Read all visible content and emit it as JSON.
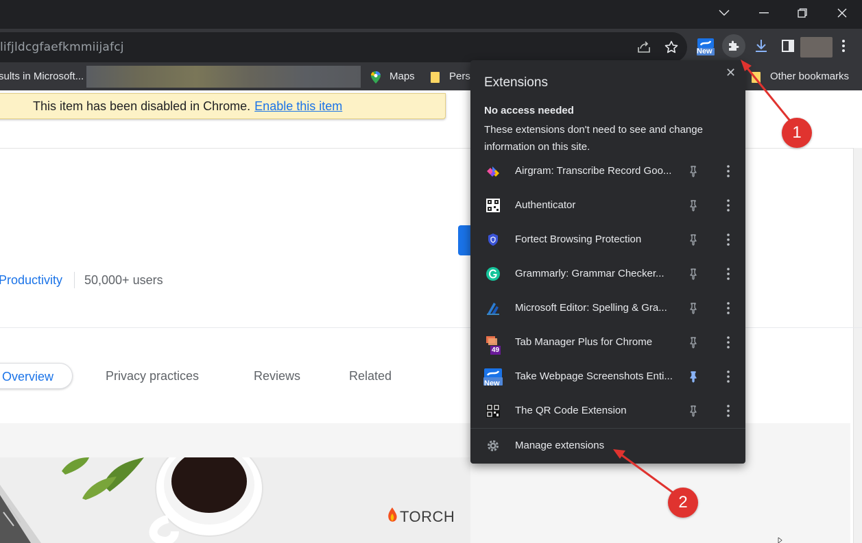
{
  "omnibox": {
    "url_fragment": "lifjldcgfaefkmmiijafcj"
  },
  "toolbar": {
    "new_badge": "New"
  },
  "bookmarks": {
    "item1": "sults in Microsoft...",
    "maps": "Maps",
    "personal": "Perso",
    "other": "Other bookmarks"
  },
  "infobar": {
    "message": "This item has been disabled in Chrome.",
    "link": "Enable this item"
  },
  "store": {
    "category": "Productivity",
    "users": "50,000+ users",
    "tabs": [
      "Overview",
      "Privacy practices",
      "Reviews",
      "Related"
    ],
    "gallery_brand": "TORCH"
  },
  "popup": {
    "title": "Extensions",
    "section_heading": "No access needed",
    "section_desc": "These extensions don't need to see and change information on this site.",
    "extensions": [
      {
        "name": "Airgram: Transcribe Record Goo...",
        "pinned": false
      },
      {
        "name": "Authenticator",
        "pinned": false
      },
      {
        "name": "Fortect Browsing Protection",
        "pinned": false
      },
      {
        "name": "Grammarly: Grammar Checker...",
        "pinned": false
      },
      {
        "name": "Microsoft Editor: Spelling & Gra...",
        "pinned": false
      },
      {
        "name": "Tab Manager Plus for Chrome",
        "pinned": false,
        "badge": "49"
      },
      {
        "name": "Take Webpage Screenshots Enti...",
        "pinned": true,
        "badge": "New"
      },
      {
        "name": "The QR Code Extension",
        "pinned": false
      }
    ],
    "manage": "Manage extensions"
  },
  "annotations": [
    "1",
    "2"
  ],
  "colors": {
    "accent": "#1a73e8",
    "annotation": "#e0332f",
    "pin_active": "#8ab4f8"
  }
}
